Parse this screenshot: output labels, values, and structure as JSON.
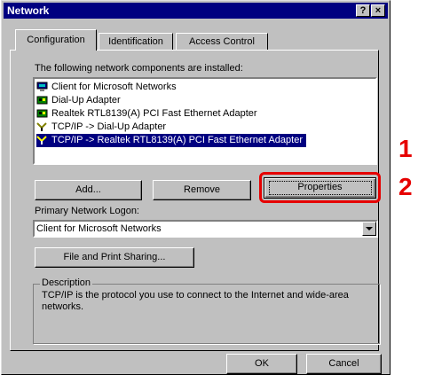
{
  "window": {
    "title": "Network",
    "help_btn": "?",
    "close_btn": "×"
  },
  "tabs": [
    {
      "label": "Configuration"
    },
    {
      "label": "Identification"
    },
    {
      "label": "Access Control"
    }
  ],
  "components_label": "The following network components are installed:",
  "components": [
    {
      "label": "Client for Microsoft Networks",
      "icon": "network-client-icon"
    },
    {
      "label": "Dial-Up Adapter",
      "icon": "network-adapter-icon"
    },
    {
      "label": "Realtek RTL8139(A) PCI Fast Ethernet Adapter",
      "icon": "network-adapter-icon"
    },
    {
      "label": "TCP/IP -> Dial-Up Adapter",
      "icon": "protocol-icon"
    },
    {
      "label": "TCP/IP -> Realtek RTL8139(A) PCI Fast Ethernet Adapter",
      "icon": "protocol-icon",
      "selected": true
    }
  ],
  "buttons": {
    "add": "Add...",
    "remove": "Remove",
    "properties": "Properties",
    "file_print": "File and Print Sharing...",
    "ok": "OK",
    "cancel": "Cancel"
  },
  "logon": {
    "label": "Primary Network Logon:",
    "value": "Client for Microsoft Networks"
  },
  "description": {
    "label": "Description",
    "text": "TCP/IP is the protocol you use to connect to the Internet and wide-area networks."
  },
  "annotations": {
    "step1": "1",
    "step2": "2",
    "color": "#e60000"
  },
  "colors": {
    "titlebar": "#000080",
    "face": "#c0c0c0",
    "selection": "#000080"
  }
}
